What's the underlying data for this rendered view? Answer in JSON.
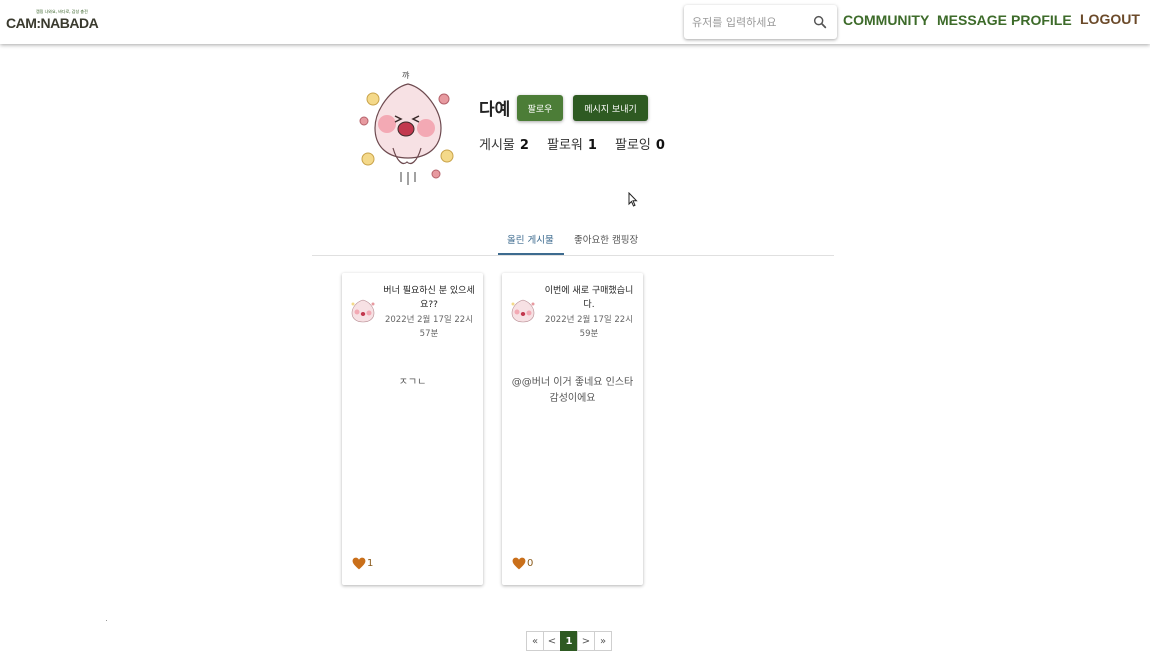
{
  "header": {
    "logo_tagline": "캠핑 나와요, 바다로, 감성 충전",
    "logo_text": "CAM:NABADA",
    "search": {
      "placeholder": "유저를 입력하세요",
      "value": ""
    },
    "nav": [
      "COMMUNITY",
      "MESSAGE",
      "PROFILE",
      "LOGOUT"
    ]
  },
  "profile": {
    "username": "다예",
    "follow_label": "팔로우",
    "message_label": "메시지 보내기",
    "stats": [
      {
        "label": "게시물",
        "value": "2"
      },
      {
        "label": "팔로워",
        "value": "1"
      },
      {
        "label": "팔로잉",
        "value": "0"
      }
    ]
  },
  "tabs": [
    "올린 게시물",
    "좋아요한 캠핑장"
  ],
  "posts": [
    {
      "title": "버너 필요하신 분 있으세요??",
      "date": "2022년 2월 17일 22시 57분",
      "content": "ㅈㄱㄴ",
      "likes": "1"
    },
    {
      "title": "이번에 새로 구매했습니다.",
      "date": "2022년 2월 17일 22시 59분",
      "content": "@@버너 이거 좋네요 인스타 감성이에요",
      "likes": "0"
    }
  ],
  "pagination": {
    "first": "«",
    "prev": "<",
    "current": "1",
    "next": ">",
    "last": "»"
  },
  "colors": {
    "brand_green": "#3d6b2a",
    "dark_green": "#2e5a22",
    "button_green": "#4c7d37",
    "like_orange": "#c96f1a",
    "tab_blue": "#3d6b8f"
  }
}
